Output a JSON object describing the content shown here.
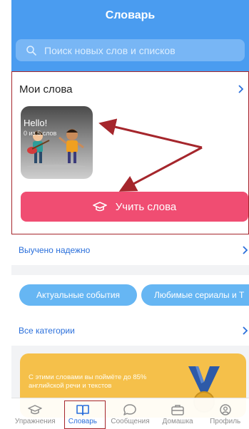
{
  "header": {
    "title": "Словарь"
  },
  "search": {
    "placeholder": "Поиск новых слов и списков"
  },
  "my_words": {
    "title": "Мои слова",
    "card": {
      "title": "Hello!",
      "count": "0 из 5 слов"
    },
    "learn_button": "Учить слова"
  },
  "learned": {
    "label": "Выучено надежно"
  },
  "chips": [
    "Актуальные события",
    "Любимые сериалы и Т"
  ],
  "categories": {
    "label": "Все категории"
  },
  "banner": {
    "text": "С этими словами вы поймёте до 85% английской речи и текстов"
  },
  "tabs": [
    {
      "label": "Упражнения",
      "icon": "graduation-cap-icon"
    },
    {
      "label": "Словарь",
      "icon": "book-icon"
    },
    {
      "label": "Сообщения",
      "icon": "chat-bubble-icon"
    },
    {
      "label": "Домашка",
      "icon": "briefcase-icon"
    },
    {
      "label": "Профиль",
      "icon": "user-circle-icon"
    }
  ],
  "colors": {
    "header": "#4a9cf0",
    "accent": "#2a6fdb",
    "learn_button": "#f04d72",
    "annotation": "#a5262c",
    "banner": "#f5c04a"
  }
}
